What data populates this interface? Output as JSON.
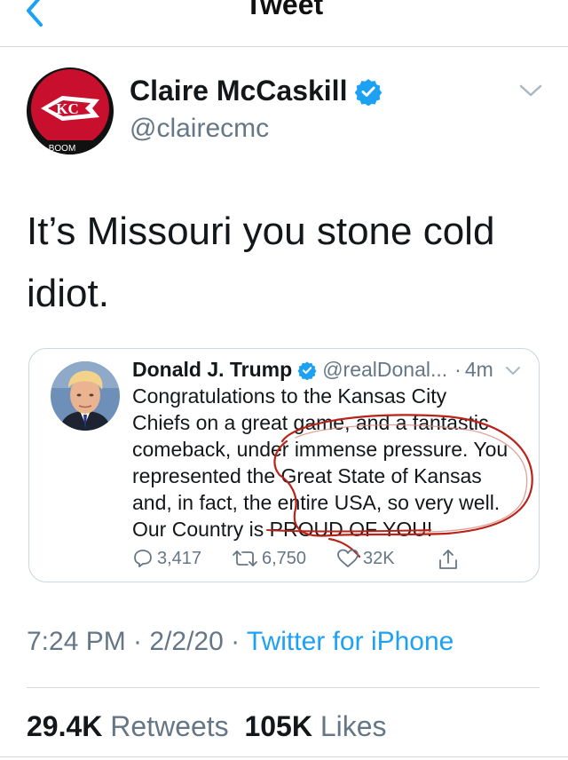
{
  "header": {
    "title": "Tweet"
  },
  "tweet": {
    "author_name": "Claire McCaskill",
    "author_handle": "@clairecmc",
    "avatar_caption": "BOOM",
    "text_lines": [
      "It’s Missouri you stone cold",
      "idiot."
    ],
    "timestamp": "7:24 PM · 2/2/20 · ",
    "source": "Twitter for iPhone",
    "retweets_count": "29.4K",
    "retweets_label": "Retweets",
    "likes_count": "105K",
    "likes_label": "Likes"
  },
  "quoted": {
    "author_name": "Donald J. Trump",
    "author_handle": "@realDonal...",
    "separator": "·",
    "time": "4m",
    "text_lines": [
      "Congratulations to the Kansas City",
      "Chiefs on a great game, and a fantastic",
      "comeback, under immense pressure. You",
      "represented the Great State of Kansas",
      "and, in fact, the entire USA, so very well.",
      "Our Country is PROUD OF YOU!"
    ],
    "replies": "3,417",
    "retweets": "6,750",
    "likes": "32K"
  },
  "colors": {
    "link": "#1da1f2",
    "secondary_text": "#657786",
    "verified": "#1da1f2",
    "annotation": "#b8231a"
  },
  "icons": {
    "back": "chevron-left-icon",
    "verified": "verified-badge-icon",
    "more": "chevron-down-icon",
    "reply": "reply-icon",
    "retweet": "retweet-icon",
    "like": "heart-icon",
    "share": "share-icon"
  }
}
